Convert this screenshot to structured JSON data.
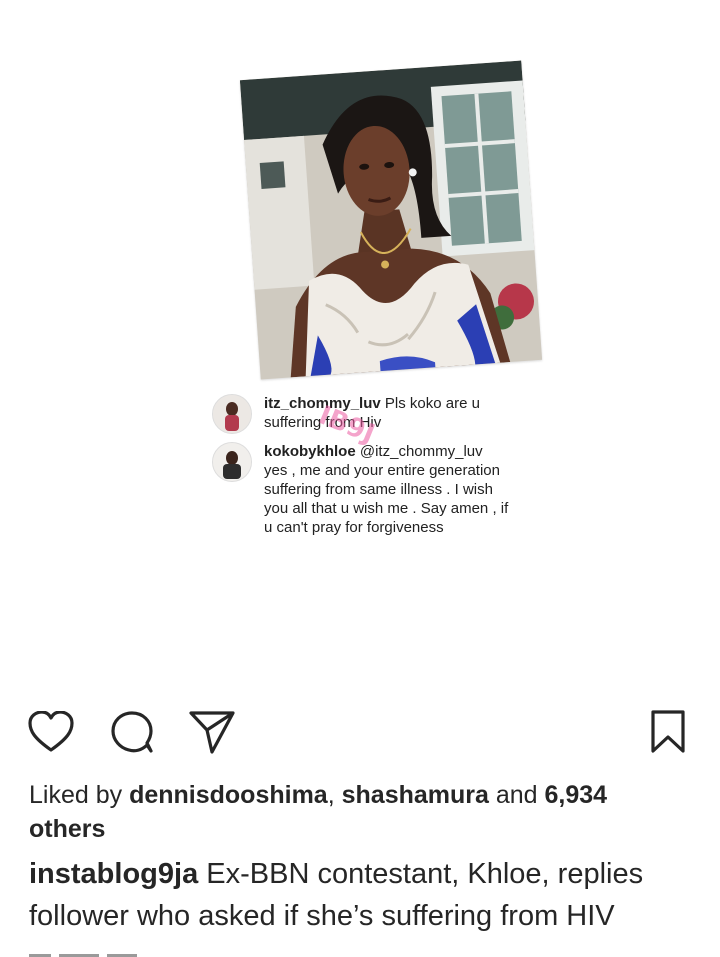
{
  "post": {
    "comments": [
      {
        "username": "itz_chommy_luv",
        "text": "Pls koko are u suffering from Hiv"
      },
      {
        "username": "kokobykhloe",
        "mention": "@itz_chommy_luv",
        "text": "yes , me and your entire generation suffering from same illness . I wish you all that u wish me . Say amen , if u can't pray for forgiveness"
      }
    ],
    "watermark": "IB9J"
  },
  "actions": {
    "like_icon": "heart-icon",
    "comment_icon": "comment-icon",
    "share_icon": "paper-plane-icon",
    "save_icon": "bookmark-icon"
  },
  "likes": {
    "prefix": "Liked by ",
    "user1": "dennisdooshima",
    "separator": ", ",
    "user2": "shashamura",
    "and": " and ",
    "count": "6,934",
    "suffix": "others"
  },
  "caption": {
    "username": "instablog9ja",
    "text": "Ex-BBN contestant, Khloe, replies follower who asked if she’s suffering from HIV"
  }
}
